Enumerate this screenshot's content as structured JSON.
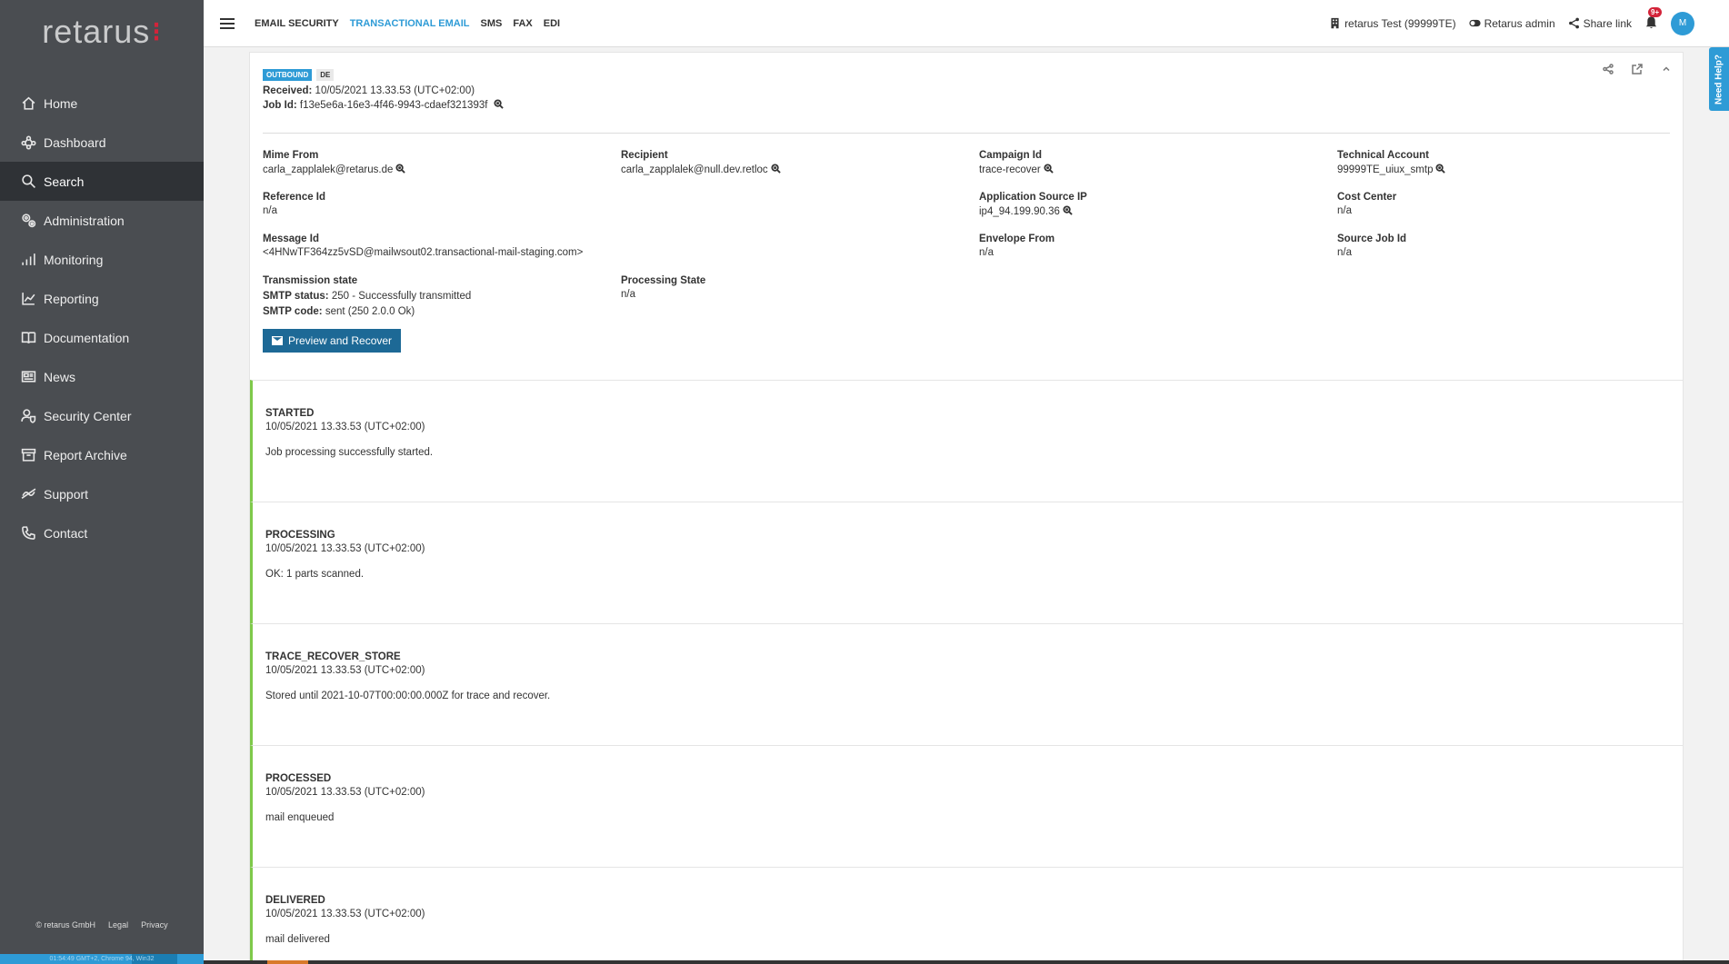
{
  "brand": {
    "logo_text": "retarus"
  },
  "sidebar": {
    "items": [
      {
        "label": "Home",
        "icon": "home-icon",
        "active": false
      },
      {
        "label": "Dashboard",
        "icon": "dashboard-icon",
        "active": false
      },
      {
        "label": "Search",
        "icon": "search-icon",
        "active": true
      },
      {
        "label": "Administration",
        "icon": "gears-icon",
        "active": false
      },
      {
        "label": "Monitoring",
        "icon": "bar-chart-icon",
        "active": false
      },
      {
        "label": "Reporting",
        "icon": "line-chart-icon",
        "active": false
      },
      {
        "label": "Documentation",
        "icon": "book-icon",
        "active": false
      },
      {
        "label": "News",
        "icon": "newspaper-icon",
        "active": false
      },
      {
        "label": "Security Center",
        "icon": "user-shield-icon",
        "active": false
      },
      {
        "label": "Report Archive",
        "icon": "archive-icon",
        "active": false
      },
      {
        "label": "Support",
        "icon": "support-icon",
        "active": false
      },
      {
        "label": "Contact",
        "icon": "phone-icon",
        "active": false
      }
    ],
    "footer": {
      "copyright": "© retarus GmbH",
      "legal": "Legal",
      "privacy": "Privacy"
    },
    "status_text": "01:54:49 GMT+2, Chrome 94, Win32"
  },
  "topbar": {
    "tabs": [
      {
        "label": "EMAIL SECURITY",
        "active": false
      },
      {
        "label": "TRANSACTIONAL EMAIL",
        "active": true
      },
      {
        "label": "SMS",
        "active": false
      },
      {
        "label": "FAX",
        "active": false
      },
      {
        "label": "EDI",
        "active": false
      }
    ],
    "account": "retarus Test (99999TE)",
    "role": "Retarus admin",
    "share": "Share link",
    "notifications_badge": "9+",
    "avatar_initial": "M"
  },
  "help": {
    "label": "Need Help?"
  },
  "job": {
    "direction_tag": "OUTBOUND",
    "region_tag": "DE",
    "received_label": "Received:",
    "received_value": "10/05/2021 13.33.53 (UTC+02:00)",
    "job_id_label": "Job Id:",
    "job_id_value": "f13e5e6a-16e3-4f46-9943-cdaef321393f"
  },
  "fields": {
    "mime_from": {
      "label": "Mime From",
      "value": "carla_zapplalek@retarus.de"
    },
    "recipient": {
      "label": "Recipient",
      "value": "carla_zapplalek@null.dev.retloc"
    },
    "campaign_id": {
      "label": "Campaign Id",
      "value": "trace-recover"
    },
    "technical_account": {
      "label": "Technical Account",
      "value": "99999TE_uiux_smtp"
    },
    "reference_id": {
      "label": "Reference Id",
      "value": "n/a"
    },
    "app_source_ip": {
      "label": "Application Source IP",
      "value": "ip4_94.199.90.36"
    },
    "cost_center": {
      "label": "Cost Center",
      "value": "n/a"
    },
    "message_id": {
      "label": "Message Id",
      "value": "<4HNwTF364zz5vSD@mailwsout02.transactional-mail-staging.com>"
    },
    "envelope_from": {
      "label": "Envelope From",
      "value": "n/a"
    },
    "source_job_id": {
      "label": "Source Job Id",
      "value": "n/a"
    },
    "transmission_state": {
      "label": "Transmission state",
      "smtp_status_label": "SMTP status:",
      "smtp_status_value": "250 - Successfully transmitted",
      "smtp_code_label": "SMTP code:",
      "smtp_code_value": "sent (250 2.0.0 Ok)"
    },
    "processing_state": {
      "label": "Processing State",
      "value": "n/a"
    }
  },
  "actions": {
    "preview_recover": "Preview and Recover"
  },
  "events": [
    {
      "name": "STARTED",
      "time": "10/05/2021 13.33.53 (UTC+02:00)",
      "message": "Job processing successfully started."
    },
    {
      "name": "PROCESSING",
      "time": "10/05/2021 13.33.53 (UTC+02:00)",
      "message": "OK: 1 parts scanned."
    },
    {
      "name": "TRACE_RECOVER_STORE",
      "time": "10/05/2021 13.33.53 (UTC+02:00)",
      "message": "Stored until 2021-10-07T00:00:00.000Z for trace and recover."
    },
    {
      "name": "PROCESSED",
      "time": "10/05/2021 13.33.53 (UTC+02:00)",
      "message": "mail enqueued"
    },
    {
      "name": "DELIVERED",
      "time": "10/05/2021 13.33.53 (UTC+02:00)",
      "message": "mail delivered"
    }
  ],
  "colors": {
    "accent": "#2e9bd6",
    "sidebar_bg": "#4a4d51",
    "brand_red": "#d3243a",
    "event_border": "#7ec94a",
    "button": "#1d6996"
  }
}
